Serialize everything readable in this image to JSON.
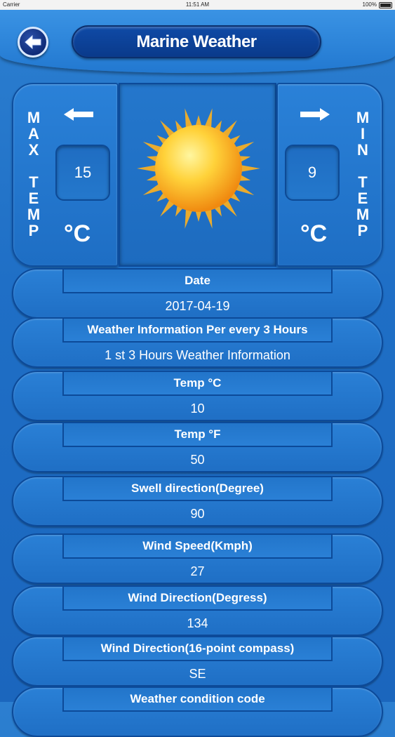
{
  "status_bar": {
    "carrier": "Carrier",
    "time": "11:51 AM",
    "battery": "100%"
  },
  "header": {
    "title": "Marine Weather",
    "back_icon": "back-arrow-icon"
  },
  "max_temp": {
    "label": "MAX TEMP",
    "value": "15",
    "unit": "°C",
    "icon": "left-arrow-icon"
  },
  "min_temp": {
    "label": "MIN TEMP",
    "value": "9",
    "unit": "°C",
    "icon": "right-arrow-icon"
  },
  "weather_icon": "sun-icon",
  "rows": [
    {
      "label": "Date",
      "value": "2017-04-19"
    },
    {
      "label": "Weather Information Per every 3 Hours",
      "value": "1 st 3 Hours Weather Information"
    },
    {
      "label": "Temp °C",
      "value": "10"
    },
    {
      "label": "Temp °F",
      "value": "50"
    },
    {
      "label": "Swell direction(Degree)",
      "value": "90"
    },
    {
      "label": "Wind Speed(Kmph)",
      "value": "27"
    },
    {
      "label": "Wind Direction(Degress)",
      "value": "134"
    },
    {
      "label": "Wind Direction(16-point compass)",
      "value": "SE"
    },
    {
      "label": "Weather condition code",
      "value": ""
    }
  ]
}
